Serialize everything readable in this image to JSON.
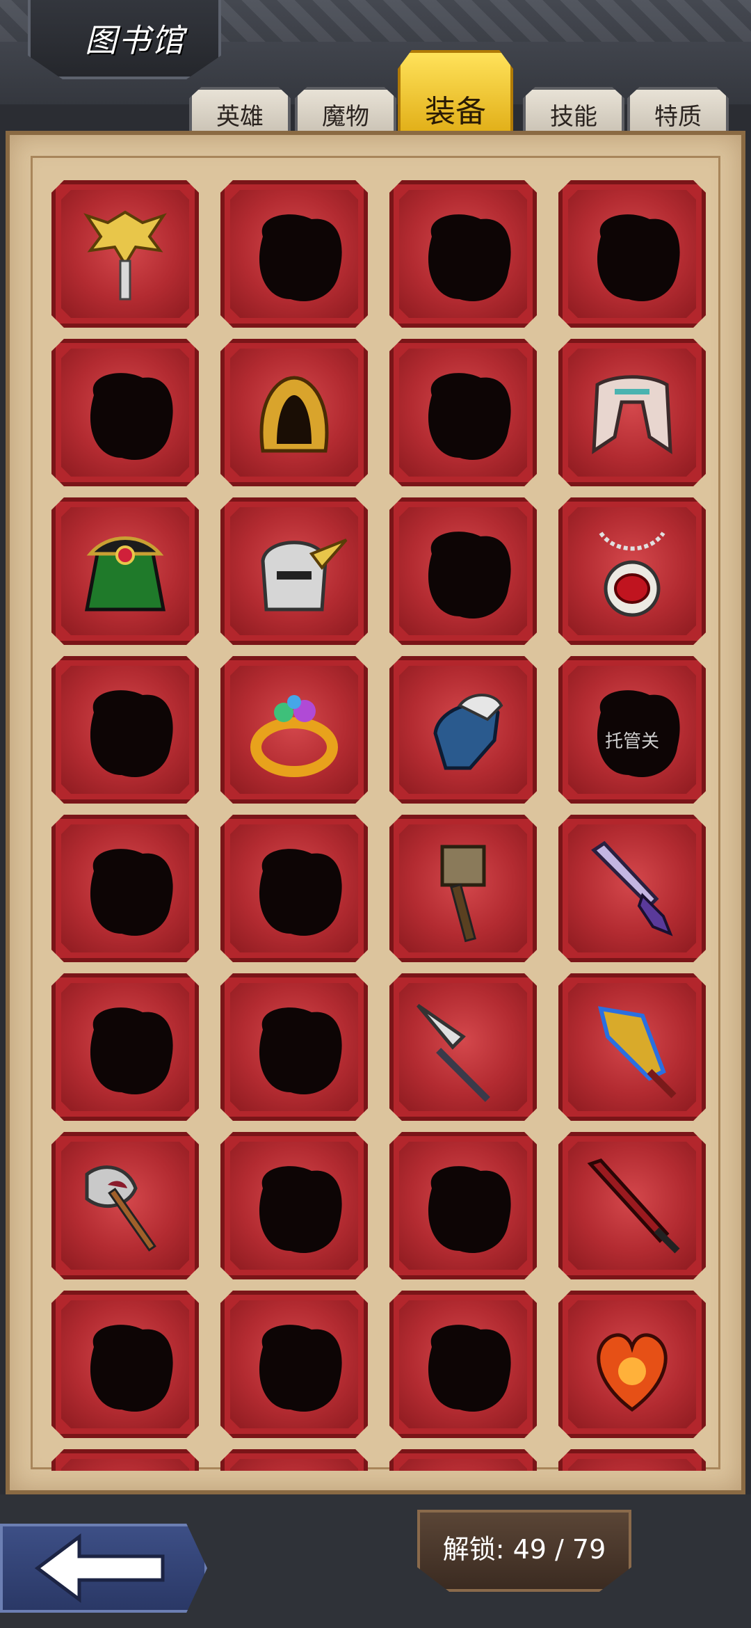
{
  "header": {
    "title": "图书馆"
  },
  "tabs": [
    {
      "label": "英雄",
      "active": false
    },
    {
      "label": "魔物",
      "active": false
    },
    {
      "label": "装备",
      "active": true
    },
    {
      "label": "技能",
      "active": false
    },
    {
      "label": "特质",
      "active": false
    }
  ],
  "grid": {
    "items": [
      {
        "icon": "winged-helmet-icon",
        "unlocked": true
      },
      {
        "icon": "locked-silhouette-icon",
        "unlocked": false
      },
      {
        "icon": "locked-silhouette-icon",
        "unlocked": false
      },
      {
        "icon": "locked-silhouette-icon",
        "unlocked": false
      },
      {
        "icon": "locked-silhouette-icon",
        "unlocked": false
      },
      {
        "icon": "golden-hood-icon",
        "unlocked": true
      },
      {
        "icon": "locked-silhouette-icon",
        "unlocked": false
      },
      {
        "icon": "mantle-collar-icon",
        "unlocked": true
      },
      {
        "icon": "pirate-hat-icon",
        "unlocked": true
      },
      {
        "icon": "knight-helmet-icon",
        "unlocked": true
      },
      {
        "icon": "locked-silhouette-icon",
        "unlocked": false
      },
      {
        "icon": "ruby-amulet-icon",
        "unlocked": true
      },
      {
        "icon": "locked-silhouette-icon",
        "unlocked": false
      },
      {
        "icon": "gem-ring-icon",
        "unlocked": true
      },
      {
        "icon": "frost-gauntlet-icon",
        "unlocked": true
      },
      {
        "icon": "locked-silhouette-icon",
        "unlocked": false,
        "label": "托管关"
      },
      {
        "icon": "locked-silhouette-icon",
        "unlocked": false
      },
      {
        "icon": "locked-silhouette-icon",
        "unlocked": false
      },
      {
        "icon": "war-hammer-icon",
        "unlocked": true
      },
      {
        "icon": "crystal-sword-icon",
        "unlocked": true
      },
      {
        "icon": "locked-silhouette-icon",
        "unlocked": false
      },
      {
        "icon": "locked-silhouette-icon",
        "unlocked": false
      },
      {
        "icon": "spear-icon",
        "unlocked": true
      },
      {
        "icon": "lightning-blade-icon",
        "unlocked": true
      },
      {
        "icon": "battle-axe-icon",
        "unlocked": true
      },
      {
        "icon": "locked-silhouette-icon",
        "unlocked": false
      },
      {
        "icon": "locked-silhouette-icon",
        "unlocked": false
      },
      {
        "icon": "red-sword-icon",
        "unlocked": true
      },
      {
        "icon": "locked-silhouette-icon",
        "unlocked": false
      },
      {
        "icon": "locked-silhouette-icon",
        "unlocked": false
      },
      {
        "icon": "locked-silhouette-icon",
        "unlocked": false
      },
      {
        "icon": "fire-heart-icon",
        "unlocked": true
      },
      {
        "icon": "locked-silhouette-icon",
        "unlocked": false
      },
      {
        "icon": "locked-silhouette-icon",
        "unlocked": false
      },
      {
        "icon": "locked-silhouette-icon",
        "unlocked": false
      },
      {
        "icon": "locked-silhouette-icon",
        "unlocked": false
      }
    ]
  },
  "footer": {
    "unlock_text": "解锁: 49 / 79",
    "back_icon": "back-arrow-icon"
  },
  "colors": {
    "cell_red": "#b3262c",
    "panel": "#dcc49d",
    "tab_active": "#f0c020"
  }
}
